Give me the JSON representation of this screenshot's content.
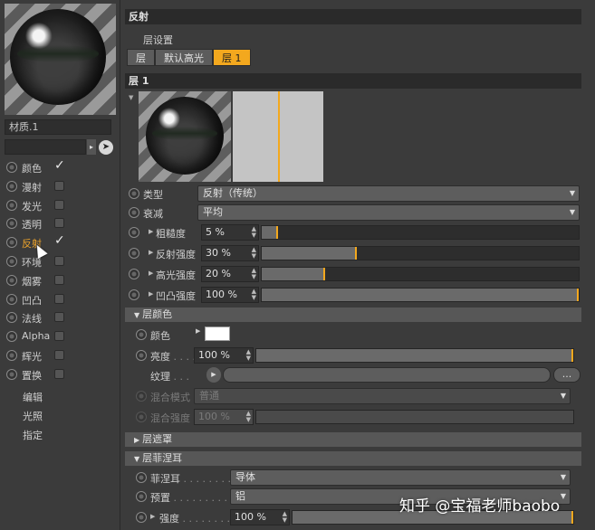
{
  "material": {
    "name": "材质.1"
  },
  "channels": [
    {
      "label": "颜色",
      "checked": true
    },
    {
      "label": "漫射",
      "checked": false
    },
    {
      "label": "发光",
      "checked": false
    },
    {
      "label": "透明",
      "checked": false
    },
    {
      "label": "反射",
      "checked": true,
      "active": true
    },
    {
      "label": "环境",
      "checked": false
    },
    {
      "label": "烟雾",
      "checked": false
    },
    {
      "label": "凹凸",
      "checked": false
    },
    {
      "label": "法线",
      "checked": false
    },
    {
      "label": "Alpha",
      "checked": false
    },
    {
      "label": "辉光",
      "checked": false
    },
    {
      "label": "置换",
      "checked": false
    }
  ],
  "extra_items": [
    "编辑",
    "光照",
    "指定"
  ],
  "panel": {
    "title": "反射",
    "layer_setup_label": "层设置",
    "tabs": [
      {
        "label": "层",
        "active": false
      },
      {
        "label": "默认高光",
        "active": false
      },
      {
        "label": "层 1",
        "active": true
      }
    ],
    "layer_header": "层 1",
    "check_mark": "✓"
  },
  "layer_props": {
    "type": {
      "label": "类型",
      "value": "反射（传统）"
    },
    "attenuation": {
      "label": "衰减",
      "value": "平均"
    },
    "roughness": {
      "label": "粗糙度",
      "value": "5 %",
      "level": 0.05
    },
    "reflection_strength": {
      "label": "反射强度",
      "value": "30 %",
      "level": 0.3
    },
    "specular_strength": {
      "label": "高光强度",
      "value": "20 %",
      "level": 0.2
    },
    "bump_strength": {
      "label": "凹凸强度",
      "value": "100 %",
      "level": 1.0
    }
  },
  "layer_color": {
    "header": "层颜色",
    "color_label": "颜色",
    "color_value": "#ffffff",
    "brightness": {
      "label": "亮度",
      "value": "100 %",
      "level": 1.0
    },
    "texture_label": "纹理",
    "texture_more": "...",
    "mix_mode": {
      "label": "混合模式",
      "value": "普通"
    },
    "mix_strength": {
      "label": "混合强度",
      "value": "100 %"
    }
  },
  "layer_mask": {
    "header": "层遮罩"
  },
  "layer_fresnel": {
    "header": "层菲涅耳",
    "fresnel": {
      "label": "菲涅耳",
      "value": "导体"
    },
    "preset": {
      "label": "预置",
      "value": "铝"
    },
    "strength": {
      "label": "强度",
      "value": "100 %",
      "level": 1.0
    }
  },
  "watermark": "知乎 @宝福老师baobo",
  "accent_color": "#f3a81e"
}
